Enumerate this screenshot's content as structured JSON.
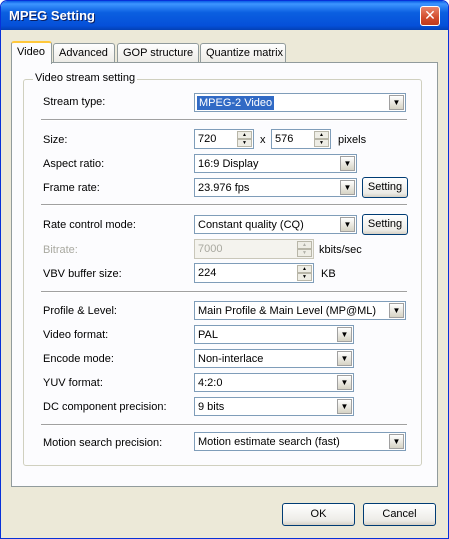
{
  "window": {
    "title": "MPEG Setting",
    "close_glyph": "✕"
  },
  "tabs": [
    "Video",
    "Advanced",
    "GOP structure",
    "Quantize matrix"
  ],
  "group_title": "Video stream setting",
  "stream_type": {
    "label": "Stream type:",
    "value": "MPEG-2 Video"
  },
  "size": {
    "label": "Size:",
    "width": "720",
    "x": "x",
    "height": "576",
    "unit": "pixels"
  },
  "aspect_ratio": {
    "label": "Aspect ratio:",
    "value": "16:9 Display"
  },
  "frame_rate": {
    "label": "Frame rate:",
    "value": "23.976 fps",
    "button": "Setting"
  },
  "rate_control": {
    "label": "Rate control mode:",
    "value": "Constant quality (CQ)",
    "button": "Setting"
  },
  "bitrate": {
    "label": "Bitrate:",
    "value": "7000",
    "unit": "kbits/sec"
  },
  "vbv": {
    "label": "VBV buffer size:",
    "value": "224",
    "unit": "KB"
  },
  "profile_level": {
    "label": "Profile & Level:",
    "value": "Main Profile & Main Level (MP@ML)"
  },
  "video_format": {
    "label": "Video format:",
    "value": "PAL"
  },
  "encode_mode": {
    "label": "Encode mode:",
    "value": "Non-interlace"
  },
  "yuv_format": {
    "label": "YUV format:",
    "value": "4:2:0"
  },
  "dc_precision": {
    "label": "DC component precision:",
    "value": "9 bits"
  },
  "motion_search": {
    "label": "Motion search precision:",
    "value": "Motion estimate search (fast)"
  },
  "footer": {
    "ok": "OK",
    "cancel": "Cancel"
  },
  "icons": {
    "dropdown": "▼",
    "spin_up": "▲",
    "spin_down": "▼"
  }
}
